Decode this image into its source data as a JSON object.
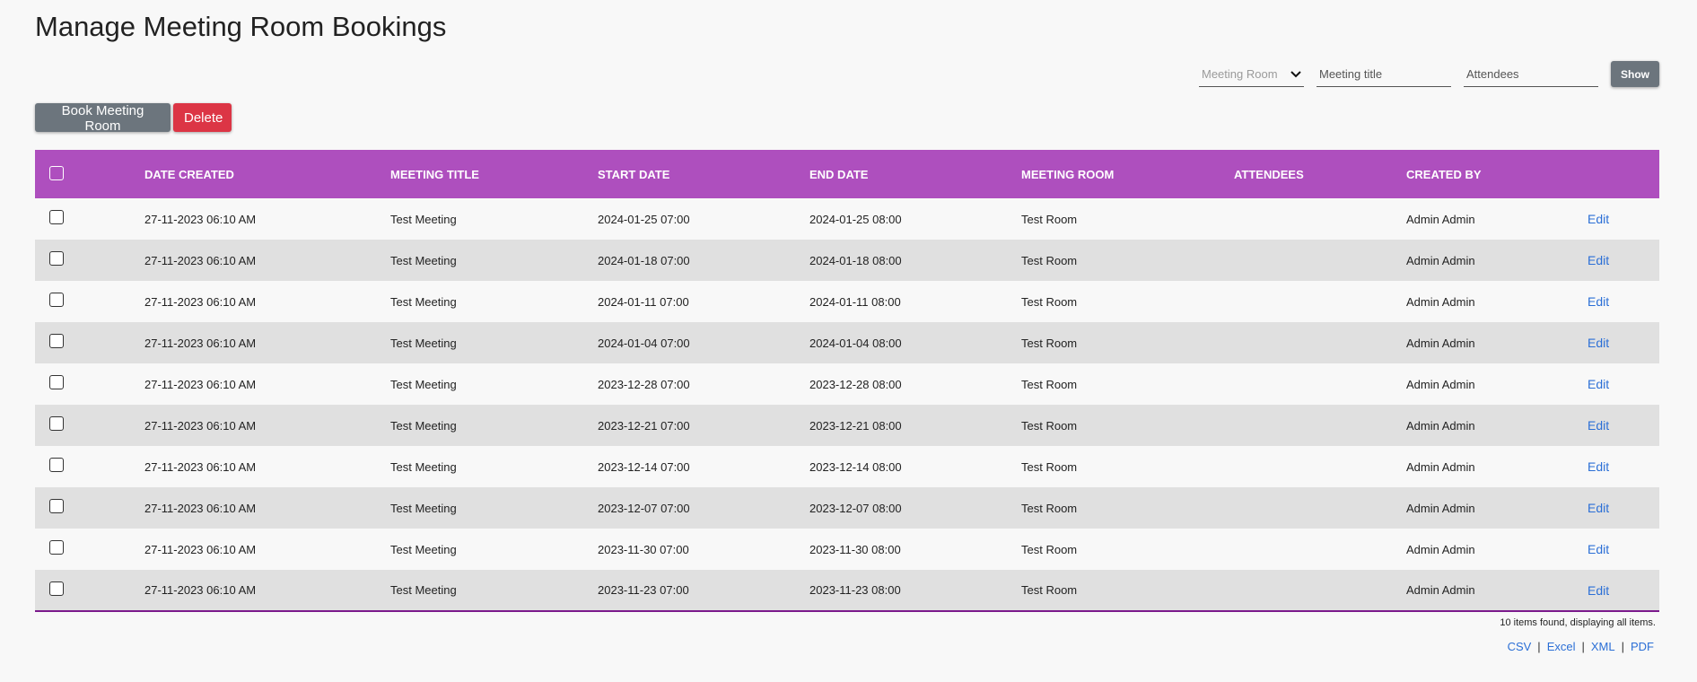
{
  "page": {
    "title": "Manage Meeting Room Bookings"
  },
  "filters": {
    "room_placeholder": "Meeting Room",
    "title_placeholder": "Meeting title",
    "attendees_placeholder": "Attendees",
    "show_label": "Show"
  },
  "actions": {
    "book_label": "Book Meeting Room",
    "delete_label": "Delete"
  },
  "colors": {
    "header": "#ae4fbe",
    "primary_btn": "#6c757d",
    "danger_btn": "#dc3545",
    "link": "#2b6fd6"
  },
  "table": {
    "columns": [
      "DATE CREATED",
      "MEETING TITLE",
      "START DATE",
      "END DATE",
      "MEETING ROOM",
      "ATTENDEES",
      "CREATED BY"
    ],
    "rows": [
      {
        "date_created": "27-11-2023 06:10 AM",
        "title": "Test Meeting",
        "start": "2024-01-25 07:00",
        "end": "2024-01-25 08:00",
        "room": "Test Room",
        "attendees": "",
        "created_by": "Admin Admin",
        "edit": "Edit"
      },
      {
        "date_created": "27-11-2023 06:10 AM",
        "title": "Test Meeting",
        "start": "2024-01-18 07:00",
        "end": "2024-01-18 08:00",
        "room": "Test Room",
        "attendees": "",
        "created_by": "Admin Admin",
        "edit": "Edit"
      },
      {
        "date_created": "27-11-2023 06:10 AM",
        "title": "Test Meeting",
        "start": "2024-01-11 07:00",
        "end": "2024-01-11 08:00",
        "room": "Test Room",
        "attendees": "",
        "created_by": "Admin Admin",
        "edit": "Edit"
      },
      {
        "date_created": "27-11-2023 06:10 AM",
        "title": "Test Meeting",
        "start": "2024-01-04 07:00",
        "end": "2024-01-04 08:00",
        "room": "Test Room",
        "attendees": "",
        "created_by": "Admin Admin",
        "edit": "Edit"
      },
      {
        "date_created": "27-11-2023 06:10 AM",
        "title": "Test Meeting",
        "start": "2023-12-28 07:00",
        "end": "2023-12-28 08:00",
        "room": "Test Room",
        "attendees": "",
        "created_by": "Admin Admin",
        "edit": "Edit"
      },
      {
        "date_created": "27-11-2023 06:10 AM",
        "title": "Test Meeting",
        "start": "2023-12-21 07:00",
        "end": "2023-12-21 08:00",
        "room": "Test Room",
        "attendees": "",
        "created_by": "Admin Admin",
        "edit": "Edit"
      },
      {
        "date_created": "27-11-2023 06:10 AM",
        "title": "Test Meeting",
        "start": "2023-12-14 07:00",
        "end": "2023-12-14 08:00",
        "room": "Test Room",
        "attendees": "",
        "created_by": "Admin Admin",
        "edit": "Edit"
      },
      {
        "date_created": "27-11-2023 06:10 AM",
        "title": "Test Meeting",
        "start": "2023-12-07 07:00",
        "end": "2023-12-07 08:00",
        "room": "Test Room",
        "attendees": "",
        "created_by": "Admin Admin",
        "edit": "Edit"
      },
      {
        "date_created": "27-11-2023 06:10 AM",
        "title": "Test Meeting",
        "start": "2023-11-30 07:00",
        "end": "2023-11-30 08:00",
        "room": "Test Room",
        "attendees": "",
        "created_by": "Admin Admin",
        "edit": "Edit"
      },
      {
        "date_created": "27-11-2023 06:10 AM",
        "title": "Test Meeting",
        "start": "2023-11-23 07:00",
        "end": "2023-11-23 08:00",
        "room": "Test Room",
        "attendees": "",
        "created_by": "Admin Admin",
        "edit": "Edit"
      }
    ]
  },
  "footer": {
    "summary": "10 items found, displaying all items.",
    "exports": [
      "CSV",
      "Excel",
      "XML",
      "PDF"
    ]
  }
}
